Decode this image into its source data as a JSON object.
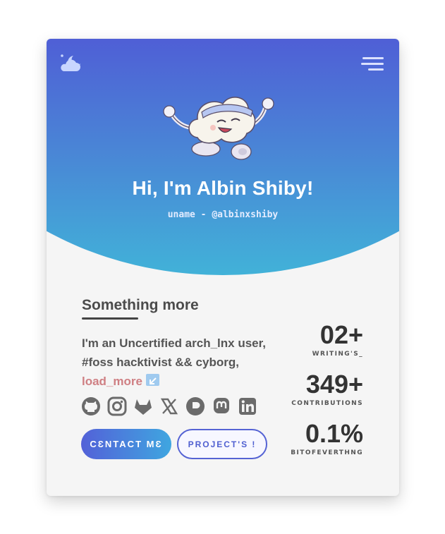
{
  "hero": {
    "title": "Hi, I'm Albin Shiby!",
    "subtitle": "uname - @albinxshiby",
    "theme_icon": "cloud-moon-icon",
    "menu_icon": "hamburger-menu-icon",
    "mascot": "meditating-cloud-mascot"
  },
  "about": {
    "section_title": "Something more",
    "bio_line1": "I'm an Uncertified arch_lnx user,",
    "bio_line2": "#foss hacktivist && cyborg,",
    "load_more_label": "load_more",
    "load_more_icon": "arrow-down-left-icon"
  },
  "socials": [
    "github-icon",
    "instagram-icon",
    "gitlab-icon",
    "x-icon",
    "pixelfed-icon",
    "mastodon-icon",
    "linkedin-icon"
  ],
  "buttons": {
    "contact_label": "CƐNTACT MƐ",
    "projects_label": "PROJECT'S !"
  },
  "stats": [
    {
      "value": "02+",
      "label": "WRITING'S_"
    },
    {
      "value": "349+",
      "label": "CONTRIBUTIONS"
    },
    {
      "value": "0.1%",
      "label": "BITOFEVERTHNG"
    }
  ],
  "colors": {
    "gradient_top": "#4f5fd6",
    "gradient_bottom": "#41b3d8",
    "card_bg": "#f5f5f5",
    "link": "#cf7f83",
    "accent": "#5563d4"
  }
}
